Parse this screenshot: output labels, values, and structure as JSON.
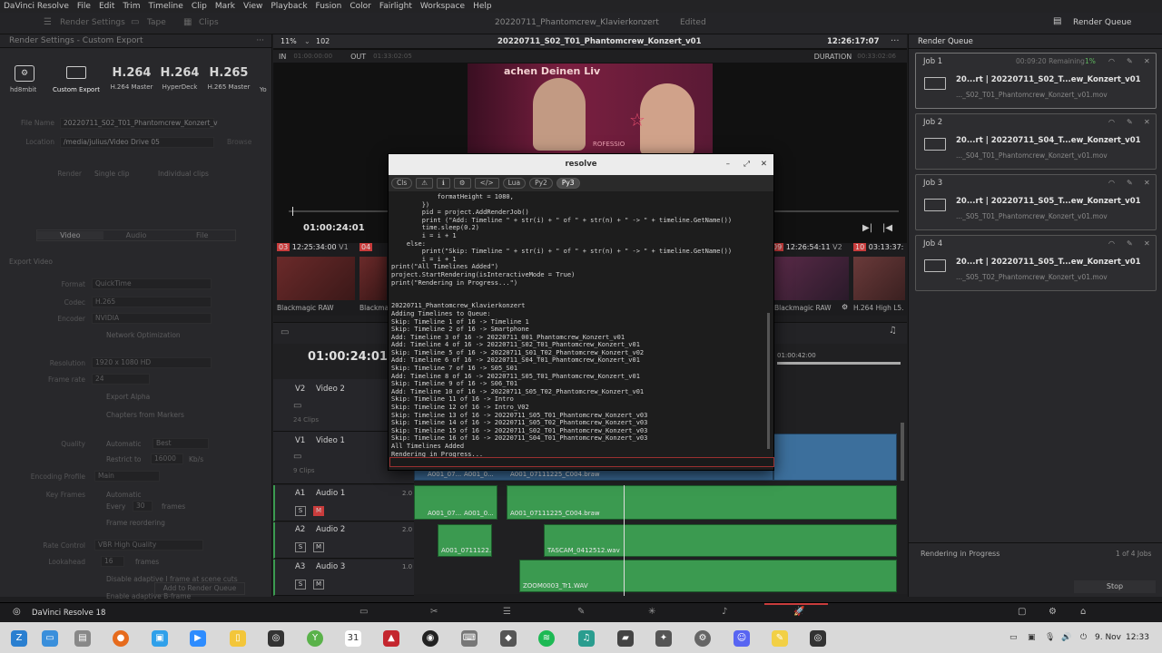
{
  "menubar": {
    "items": [
      "DaVinci Resolve",
      "File",
      "Edit",
      "Trim",
      "Timeline",
      "Clip",
      "Mark",
      "View",
      "Playback",
      "Fusion",
      "Color",
      "Fairlight",
      "Workspace",
      "Help"
    ]
  },
  "topbar": {
    "render_settings": "Render Settings",
    "tape": "Tape",
    "clips": "Clips",
    "project_title": "20220711_Phantomcrew_Klavierkonzert",
    "edited": "Edited",
    "render_queue": "Render Queue"
  },
  "render_settings": {
    "header": "Render Settings - Custom Export",
    "presets": [
      {
        "big": "",
        "label": "hd8mbit"
      },
      {
        "big": "",
        "label": "Custom Export"
      },
      {
        "big": "H.264",
        "label": "H.264 Master"
      },
      {
        "big": "H.264",
        "label": "HyperDeck"
      },
      {
        "big": "H.265",
        "label": "H.265 Master"
      },
      {
        "big": "",
        "label": "Yo"
      }
    ],
    "file_name_label": "File Name",
    "file_name": "20220711_S02_T01_Phantomcrew_Konzert_v",
    "location_label": "Location",
    "location": "/media/julius/Video Drive 05",
    "browse": "Browse",
    "render_label": "Render",
    "single_clip": "Single clip",
    "individual_clips": "Individual clips",
    "tabs": [
      "Video",
      "Audio",
      "File"
    ],
    "export_video": "Export Video",
    "format_label": "Format",
    "format": "QuickTime",
    "codec_label": "Codec",
    "codec": "H.265",
    "encoder_label": "Encoder",
    "encoder": "NVIDIA",
    "network_opt": "Network Optimization",
    "resolution_label": "Resolution",
    "resolution": "1920 x 1080 HD",
    "frame_rate_label": "Frame rate",
    "frame_rate": "24",
    "export_alpha": "Export Alpha",
    "chapters": "Chapters from Markers",
    "quality_label": "Quality",
    "automatic": "Automatic",
    "best": "Best",
    "restrict_to": "Restrict to",
    "kbs_value": "16000",
    "kbs": "Kb/s",
    "enc_profile_label": "Encoding Profile",
    "enc_profile": "Main",
    "key_frames_label": "Key Frames",
    "kf_auto": "Automatic",
    "every": "Every",
    "every_val": "30",
    "frames": "frames",
    "frame_reorder": "Frame reordering",
    "rate_control_label": "Rate Control",
    "rate_control": "VBR High Quality",
    "lookahead_label": "Lookahead",
    "lookahead_val": "16",
    "lookahead_unit": "frames",
    "disable_adaptive": "Disable adaptive I frame at scene cuts",
    "enable_adaptive_b": "Enable adaptive B-frame",
    "add_to_queue": "Add to Render Queue"
  },
  "viewer": {
    "zoom": "11%",
    "frame": "102",
    "title": "20220711_S02_T01_Phantomcrew_Konzert_v01",
    "timecode": "12:26:17:07",
    "in_label": "IN",
    "in_tc": "01:00:00:00",
    "out_label": "OUT",
    "out_tc": "01:33:02:05",
    "duration_label": "DURATION",
    "duration_tc": "00:33:02:06",
    "playhead_tc": "01:00:24:01",
    "overlay_text": "achen Deinen Liv",
    "overlay_text2": "ROFESSIO"
  },
  "clips_strip": [
    {
      "num": "03",
      "tc": "12:25:34:00",
      "trk": "V1",
      "codec": "Blackmagic RAW"
    },
    {
      "num": "04",
      "tc": "",
      "trk": "",
      "codec": "Blackmag"
    },
    {
      "num": "09",
      "tc": "12:26:54:11",
      "trk": "V2",
      "codec": "Blackmagic RAW"
    },
    {
      "num": "10",
      "tc": "03:13:37:",
      "trk": "",
      "codec": "H.264 High L5."
    }
  ],
  "timeline": {
    "timecode": "01:00:24:01",
    "ruler_tc": "01:00:42:00",
    "v2_label": "Video 2",
    "v2_clips": "24 Clips",
    "v1_label": "Video 1",
    "v1_clips": "9 Clips",
    "a1_label": "Audio 1",
    "a1_level": "2.0",
    "a2_label": "Audio 2",
    "a2_level": "2.0",
    "a3_label": "Audio 3",
    "a3_level": "1.0",
    "clip_names": [
      "A001_07...",
      "A001_0...",
      "A001_07111225_C004.braw",
      "A001_07...",
      "A001_0...",
      "A001_07111225_C004.braw",
      "A001_0711122...",
      "TASCAM_0412512.wav",
      "ZOOM0003_Tr1.WAV"
    ],
    "track_ids": [
      "V2",
      "V1",
      "A1",
      "A2",
      "A3"
    ],
    "s": "S",
    "m": "M"
  },
  "terminal": {
    "title": "resolve",
    "btn_cls": "Cls",
    "btn_lua": "Lua",
    "btn_py2": "Py2",
    "btn_py3": "Py3",
    "lines": [
      "            formatHeight = 1080,",
      "        })",
      "        pid = project.AddRenderJob()",
      "        print (\"Add: Timeline \" + str(i) + \" of \" + str(n) + \" -> \" + timeline.GetName())",
      "        time.sleep(0.2)",
      "        i = i + 1",
      "    else:",
      "        print(\"Skip: Timeline \" + str(i) + \" of \" + str(n) + \" -> \" + timeline.GetName())",
      "        i = i + 1",
      "print(\"All Timelines Added\")",
      "project.StartRendering(isInteractiveMode = True)",
      "print(\"Rendering in Progress...\")",
      "",
      "",
      "20220711_Phantomcrew_Klavierkonzert",
      "Adding Timelines to Queue:",
      "Skip: Timeline 1 of 16 -> Timeline 1",
      "Skip: Timeline 2 of 16 -> Smartphone",
      "Add: Timeline 3 of 16 -> 20220711_001_Phantomcrew_Konzert_v01",
      "Add: Timeline 4 of 16 -> 20220711_S02_T01_Phantomcrew_Konzert_v01",
      "Skip: Timeline 5 of 16 -> 20220711_S01_T02_Phantomcrew_Konzert_v02",
      "Add: Timeline 6 of 16 -> 20220711_S04_T01_Phantomcrew_Konzert_v01",
      "Skip: Timeline 7 of 16 -> S05_S01",
      "Add: Timeline 8 of 16 -> 20220711_S05_T01_Phantomcrew_Konzert_v01",
      "Skip: Timeline 9 of 16 -> S06_T01",
      "Add: Timeline 10 of 16 -> 20220711_S05_T02_Phantomcrew_Konzert_v01",
      "Skip: Timeline 11 of 16 -> Intro",
      "Skip: Timeline 12 of 16 -> Intro_V02",
      "Skip: Timeline 13 of 16 -> 20220711_S05_T01_Phantomcrew_Konzert_v03",
      "Skip: Timeline 14 of 16 -> 20220711_S05_T02_Phantomcrew_Konzert_v03",
      "Skip: Timeline 15 of 16 -> 20220711_S02_T01_Phantomcrew_Konzert_v03",
      "Skip: Timeline 16 of 16 -> 20220711_S04_T01_Phantomcrew_Konzert_v03",
      "All Timelines Added",
      "Rendering in Progress..."
    ]
  },
  "render_queue": {
    "header": "Render Queue",
    "jobs": [
      {
        "label": "Job 1",
        "remaining": "00:09:20 Remaining",
        "pct": "1%",
        "title": "20...rt | 20220711_S02_T...ew_Konzert_v01",
        "file": "..._S02_T01_Phantomcrew_Konzert_v01.mov"
      },
      {
        "label": "Job 2",
        "title": "20...rt | 20220711_S04_T...ew_Konzert_v01",
        "file": "..._S04_T01_Phantomcrew_Konzert_v01.mov"
      },
      {
        "label": "Job 3",
        "title": "20...rt | 20220711_S05_T...ew_Konzert_v01",
        "file": "..._S05_T01_Phantomcrew_Konzert_v01.mov"
      },
      {
        "label": "Job 4",
        "title": "20...rt | 20220711_S05_T...ew_Konzert_v01",
        "file": "..._S05_T02_Phantomcrew_Konzert_v01.mov"
      }
    ],
    "status": "Rendering in Progress",
    "count": "1 of 4 Jobs",
    "stop": "Stop"
  },
  "app_footer": {
    "name": "DaVinci Resolve 18"
  },
  "taskbar": {
    "date": "9. Nov",
    "time": "12:33"
  },
  "colors": {
    "accent_red": "#c93c3c",
    "track_green": "#3b9a50",
    "track_blue": "#3c6f9c",
    "progress_green": "#5fb85f"
  }
}
